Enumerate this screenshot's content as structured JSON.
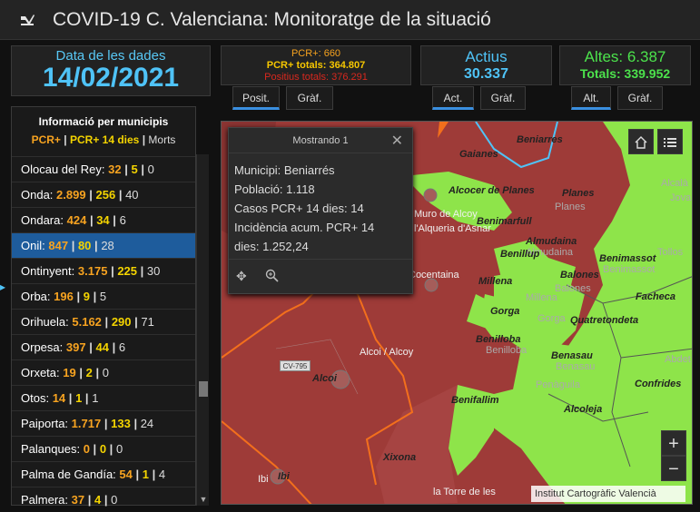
{
  "app": {
    "title": "COVID-19 C. Valenciana: Monitoratge de la situació"
  },
  "date_panel": {
    "label": "Data de les dades",
    "value": "14/02/2021"
  },
  "pcr_panel": {
    "pcr": "PCR+: 660",
    "pcr_total": "PCR+ totals: 364.807",
    "positius_total": "Positius totals: 376.291"
  },
  "actius_panel": {
    "label": "Actius",
    "value": "30.337"
  },
  "altes_panel": {
    "label": "Altes: 6.387",
    "total": "Totals: 339.952"
  },
  "tabs": {
    "pcr": [
      {
        "label": "Posit.",
        "active": true
      },
      {
        "label": "Gràf.",
        "active": false
      }
    ],
    "actius": [
      {
        "label": "Act.",
        "active": true
      },
      {
        "label": "Gràf.",
        "active": false
      }
    ],
    "altes": [
      {
        "label": "Alt.",
        "active": true
      },
      {
        "label": "Gràf.",
        "active": false
      }
    ]
  },
  "municipis": {
    "title": "Informació per municipis",
    "legend": {
      "a": "PCR+",
      "b": "PCR+ 14 dies",
      "c": "Morts",
      "sep": "|"
    },
    "rows": [
      {
        "name": "Olocau del Rey:",
        "pcr": "32",
        "pcr14": "5",
        "morts": "0",
        "selected": false
      },
      {
        "name": "Onda:",
        "pcr": "2.899",
        "pcr14": "256",
        "morts": "40",
        "selected": false
      },
      {
        "name": "Ondara:",
        "pcr": "424",
        "pcr14": "34",
        "morts": "6",
        "selected": false
      },
      {
        "name": "Onil:",
        "pcr": "847",
        "pcr14": "80",
        "morts": "28",
        "selected": true
      },
      {
        "name": "Ontinyent:",
        "pcr": "3.175",
        "pcr14": "225",
        "morts": "30",
        "selected": false
      },
      {
        "name": "Orba:",
        "pcr": "196",
        "pcr14": "9",
        "morts": "5",
        "selected": false
      },
      {
        "name": "Orihuela:",
        "pcr": "5.162",
        "pcr14": "290",
        "morts": "71",
        "selected": false
      },
      {
        "name": "Orpesa:",
        "pcr": "397",
        "pcr14": "44",
        "morts": "6",
        "selected": false
      },
      {
        "name": "Orxeta:",
        "pcr": "19",
        "pcr14": "2",
        "morts": "0",
        "selected": false
      },
      {
        "name": "Otos:",
        "pcr": "14",
        "pcr14": "1",
        "morts": "1",
        "selected": false
      },
      {
        "name": "Paiporta:",
        "pcr": "1.717",
        "pcr14": "133",
        "morts": "24",
        "selected": false
      },
      {
        "name": "Palanques:",
        "pcr": "0",
        "pcr14": "0",
        "morts": "0",
        "selected": false
      },
      {
        "name": "Palma de Gandía:",
        "pcr": "54",
        "pcr14": "1",
        "morts": "4",
        "selected": false
      },
      {
        "name": "Palmera:",
        "pcr": "37",
        "pcr14": "4",
        "morts": "0",
        "selected": false
      }
    ]
  },
  "popup": {
    "header": "Mostrando 1",
    "lines": [
      "Municipi: Beniarrés",
      "Població: 1.118",
      "Casos PCR+ 14 dies: 14",
      "Incidència acum. PCR+ 14",
      "dies: 1.252,24"
    ]
  },
  "map": {
    "attribution": "Institut Cartogràfic Valencià",
    "zoom_in": "+",
    "zoom_out": "−",
    "road_label": "CV-795",
    "labels": [
      "Beniarres",
      "Gaianes",
      "Alcocer de Planes",
      "Planes",
      "Planes",
      "Muro de Alcoy",
      "l'Alqueria d'Asnar",
      "Benimarfull",
      "Almudaina",
      "Almudaina",
      "Benillup",
      "Benimassot",
      "Benimassot",
      "Balones",
      "Balones",
      "Millena",
      "Millena",
      "Facheca",
      "Gorga",
      "Gorga",
      "Quatretondeta",
      "Cocentaina",
      "Benilloba",
      "Benilloba",
      "Alcoi / Alcoy",
      "Alcoi",
      "Benasau",
      "Benasau",
      "Penàguila",
      "Confrides",
      "Alcoleja",
      "Benifallim",
      "Xixona",
      "Ibi",
      "Ibi",
      "la Torre de les",
      "Tollos",
      "Abdet",
      "Alcalà",
      "Jova"
    ]
  },
  "colors": {
    "accent_blue": "#4fc3f7",
    "pcr_orange": "#f7a320",
    "pcr14_yellow": "#f4d400",
    "altes_green": "#4ce34c",
    "map_red": "#9e3b38",
    "map_green": "#8ee44a"
  }
}
